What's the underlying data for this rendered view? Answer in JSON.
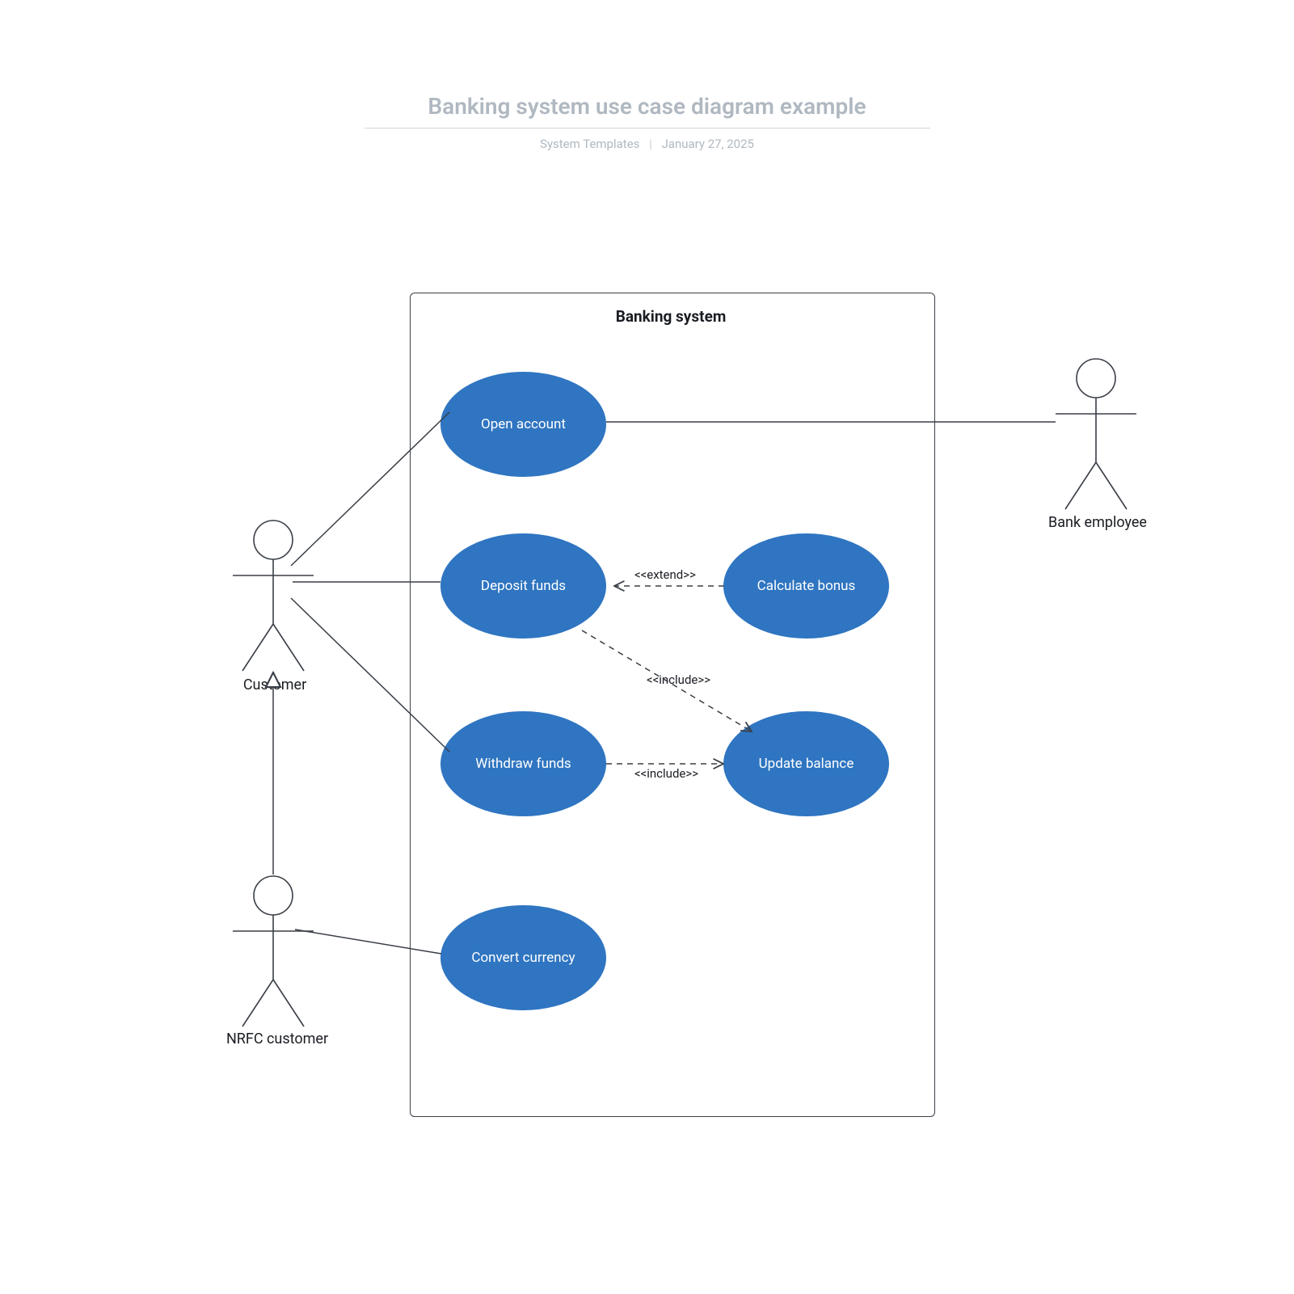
{
  "header": {
    "title": "Banking system use case diagram example",
    "author": "System Templates",
    "date": "January 27, 2025"
  },
  "system": {
    "label": "Banking system"
  },
  "actors": {
    "customer": "Customer",
    "nrfc": "NRFC customer",
    "employee": "Bank employee"
  },
  "usecases": {
    "open_account": "Open account",
    "deposit_funds": "Deposit funds",
    "calculate_bonus": "Calculate bonus",
    "withdraw_funds": "Withdraw funds",
    "update_balance": "Update balance",
    "convert_currency": "Convert currency"
  },
  "relations": {
    "extend": "<<extend>>",
    "include1": "<<include>>",
    "include2": "<<include>>"
  }
}
